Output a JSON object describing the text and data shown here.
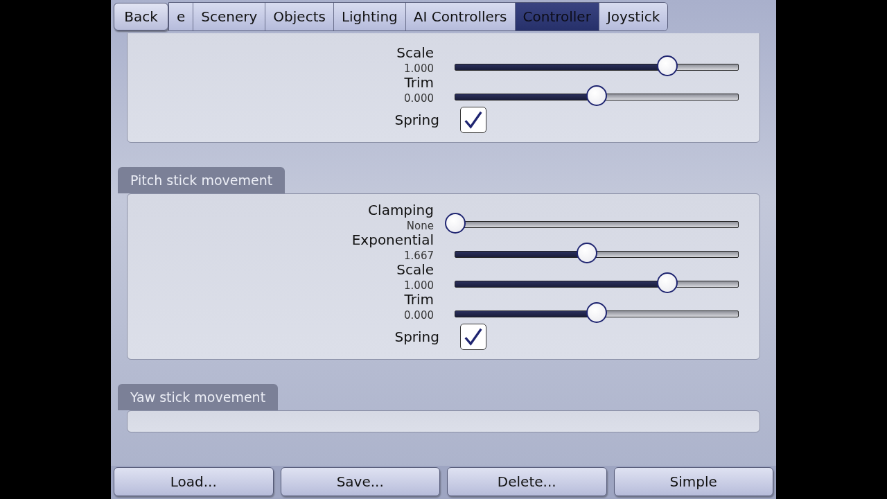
{
  "back_button": "Back",
  "tabs": [
    {
      "label": "e",
      "selected": false
    },
    {
      "label": "Scenery",
      "selected": false
    },
    {
      "label": "Objects",
      "selected": false
    },
    {
      "label": "Lighting",
      "selected": false
    },
    {
      "label": "AI Controllers",
      "selected": false
    },
    {
      "label": "Controller",
      "selected": true
    },
    {
      "label": "Joystick",
      "selected": false
    }
  ],
  "sections": [
    {
      "controls": [
        {
          "kind": "slider",
          "label": "Scale",
          "reading": "1.000",
          "level": 0.75
        },
        {
          "kind": "slider",
          "label": "Trim",
          "reading": "0.000",
          "level": 0.5
        },
        {
          "kind": "checkbox",
          "label": "Spring",
          "checked": true
        }
      ]
    },
    {
      "title": "Pitch stick movement",
      "controls": [
        {
          "kind": "slider",
          "label": "Clamping",
          "reading": "None",
          "level": 0
        },
        {
          "kind": "slider",
          "label": "Exponential",
          "reading": "1.667",
          "level": 0.466
        },
        {
          "kind": "slider",
          "label": "Scale",
          "reading": "1.000",
          "level": 0.75
        },
        {
          "kind": "slider",
          "label": "Trim",
          "reading": "0.000",
          "level": 0.5
        },
        {
          "kind": "checkbox",
          "label": "Spring",
          "checked": true
        }
      ]
    },
    {
      "title": "Yaw stick movement"
    }
  ],
  "buttons": [
    "Load...",
    "Save...",
    "Delete...",
    "Simple"
  ]
}
